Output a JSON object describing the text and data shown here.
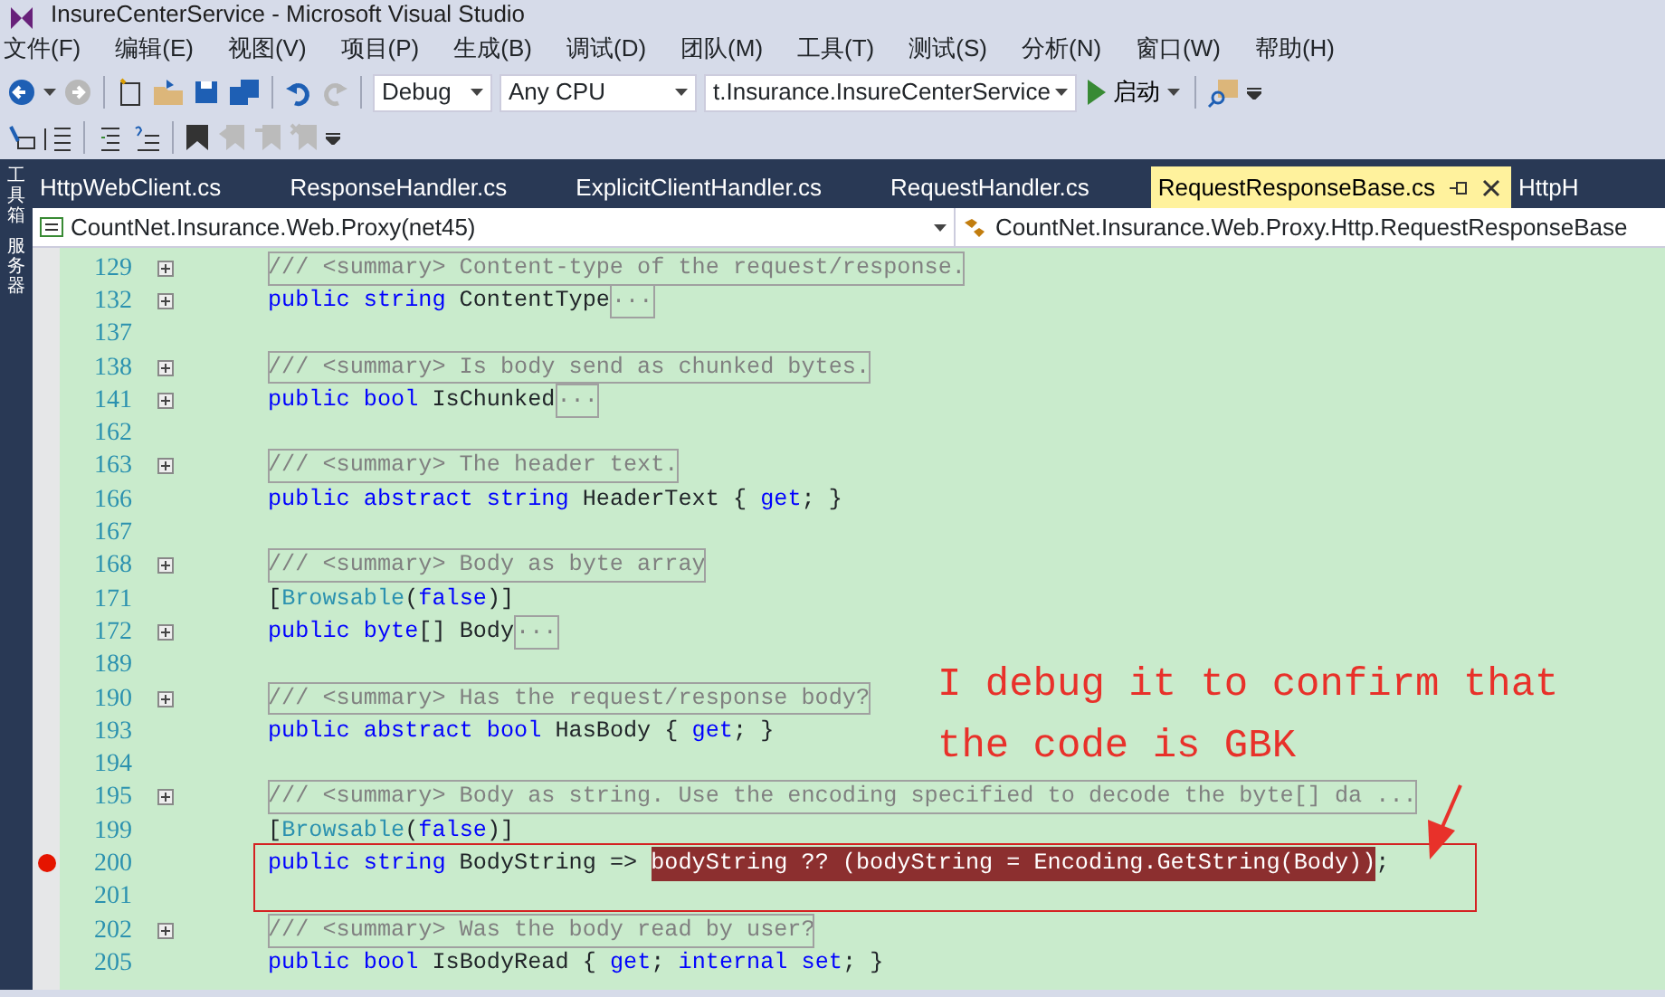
{
  "window": {
    "title": "InsureCenterService - Microsoft Visual Studio"
  },
  "menu": [
    "文件(F)",
    "编辑(E)",
    "视图(V)",
    "项目(P)",
    "生成(B)",
    "调试(D)",
    "团队(M)",
    "工具(T)",
    "测试(S)",
    "分析(N)",
    "窗口(W)",
    "帮助(H)"
  ],
  "toolbar": {
    "configuration": "Debug",
    "platform": "Any CPU",
    "startup_project": "t.Insurance.InsureCenterService",
    "start_button": "启动"
  },
  "side_rail": [
    "工具箱",
    "服务器"
  ],
  "tabs": [
    {
      "label": "HttpWebClient.cs",
      "selected": false
    },
    {
      "label": "ResponseHandler.cs",
      "selected": false
    },
    {
      "label": "ExplicitClientHandler.cs",
      "selected": false
    },
    {
      "label": "RequestHandler.cs",
      "selected": false
    },
    {
      "label": "RequestResponseBase.cs",
      "selected": true
    },
    {
      "label": "HttpH",
      "selected": false
    }
  ],
  "navigation": {
    "project": "CountNet.Insurance.Web.Proxy(net45)",
    "type": "CountNet.Insurance.Web.Proxy.Http.RequestResponseBase"
  },
  "code_lines": [
    {
      "number": "129",
      "foldable": true,
      "breakpoint": false,
      "tokens": [
        {
          "kind": "summary",
          "text": "/// <summary> Content-type of the request/response."
        }
      ]
    },
    {
      "number": "132",
      "foldable": true,
      "breakpoint": false,
      "tokens": [
        {
          "kind": "keyword",
          "text": "public string"
        },
        {
          "kind": "plain",
          "text": " ContentType"
        },
        {
          "kind": "collapsed",
          "text": "..."
        }
      ]
    },
    {
      "number": "137",
      "foldable": false,
      "breakpoint": false
    },
    {
      "number": "138",
      "foldable": true,
      "breakpoint": false,
      "tokens": [
        {
          "kind": "summary",
          "text": "/// <summary> Is body send as chunked bytes."
        }
      ]
    },
    {
      "number": "141",
      "foldable": true,
      "breakpoint": false,
      "tokens": [
        {
          "kind": "keyword",
          "text": "public bool"
        },
        {
          "kind": "plain",
          "text": " IsChunked"
        },
        {
          "kind": "collapsed",
          "text": "..."
        }
      ]
    },
    {
      "number": "162",
      "foldable": false,
      "breakpoint": false
    },
    {
      "number": "163",
      "foldable": true,
      "breakpoint": false,
      "tokens": [
        {
          "kind": "summary",
          "text": "/// <summary> The header text."
        }
      ]
    },
    {
      "number": "166",
      "foldable": false,
      "breakpoint": false,
      "tokens": [
        {
          "kind": "keyword",
          "text": "public abstract string"
        },
        {
          "kind": "plain",
          "text": " HeaderText { "
        },
        {
          "kind": "keyword",
          "text": "get"
        },
        {
          "kind": "plain",
          "text": "; }"
        }
      ]
    },
    {
      "number": "167",
      "foldable": false,
      "breakpoint": false
    },
    {
      "number": "168",
      "foldable": true,
      "breakpoint": false,
      "tokens": [
        {
          "kind": "summary",
          "text": "/// <summary> Body as byte array"
        }
      ]
    },
    {
      "number": "171",
      "foldable": false,
      "breakpoint": false,
      "tokens": [
        {
          "kind": "plain",
          "text": "["
        },
        {
          "kind": "type",
          "text": "Browsable"
        },
        {
          "kind": "plain",
          "text": "("
        },
        {
          "kind": "keyword",
          "text": "false"
        },
        {
          "kind": "plain",
          "text": ")]"
        }
      ]
    },
    {
      "number": "172",
      "foldable": true,
      "breakpoint": false,
      "tokens": [
        {
          "kind": "keyword",
          "text": "public byte"
        },
        {
          "kind": "plain",
          "text": "[] Body"
        },
        {
          "kind": "collapsed",
          "text": "..."
        }
      ]
    },
    {
      "number": "189",
      "foldable": false,
      "breakpoint": false
    },
    {
      "number": "190",
      "foldable": true,
      "breakpoint": false,
      "tokens": [
        {
          "kind": "summary",
          "text": "/// <summary> Has the request/response body?"
        }
      ]
    },
    {
      "number": "193",
      "foldable": false,
      "breakpoint": false,
      "tokens": [
        {
          "kind": "keyword",
          "text": "public abstract bool"
        },
        {
          "kind": "plain",
          "text": " HasBody { "
        },
        {
          "kind": "keyword",
          "text": "get"
        },
        {
          "kind": "plain",
          "text": "; }"
        }
      ]
    },
    {
      "number": "194",
      "foldable": false,
      "breakpoint": false
    },
    {
      "number": "195",
      "foldable": true,
      "breakpoint": false,
      "tokens": [
        {
          "kind": "summary",
          "text": "/// <summary> Body as string. Use the encoding specified to decode the byte[] da ..."
        }
      ]
    },
    {
      "number": "199",
      "foldable": false,
      "breakpoint": false,
      "tokens": [
        {
          "kind": "plain",
          "text": "["
        },
        {
          "kind": "type",
          "text": "Browsable"
        },
        {
          "kind": "plain",
          "text": "("
        },
        {
          "kind": "keyword",
          "text": "false"
        },
        {
          "kind": "plain",
          "text": ")]"
        }
      ]
    },
    {
      "number": "200",
      "foldable": false,
      "breakpoint": true,
      "tokens": [
        {
          "kind": "keyword",
          "text": "public string"
        },
        {
          "kind": "plain",
          "text": " BodyString => "
        },
        {
          "kind": "highlight",
          "text": "bodyString ?? (bodyString = Encoding.GetString(Body))"
        },
        {
          "kind": "plain",
          "text": ";"
        }
      ]
    },
    {
      "number": "201",
      "foldable": false,
      "breakpoint": false
    },
    {
      "number": "202",
      "foldable": true,
      "breakpoint": false,
      "tokens": [
        {
          "kind": "summary",
          "text": "/// <summary> Was the body read by user?"
        }
      ]
    },
    {
      "number": "205",
      "foldable": false,
      "breakpoint": false,
      "tokens": [
        {
          "kind": "keyword",
          "text": "public bool"
        },
        {
          "kind": "plain",
          "text": " IsBodyRead { "
        },
        {
          "kind": "keyword",
          "text": "get"
        },
        {
          "kind": "plain",
          "text": "; "
        },
        {
          "kind": "keyword",
          "text": "internal set"
        },
        {
          "kind": "plain",
          "text": "; }"
        }
      ]
    }
  ],
  "annotation": {
    "text": "I debug it to confirm that the code is GBK"
  }
}
